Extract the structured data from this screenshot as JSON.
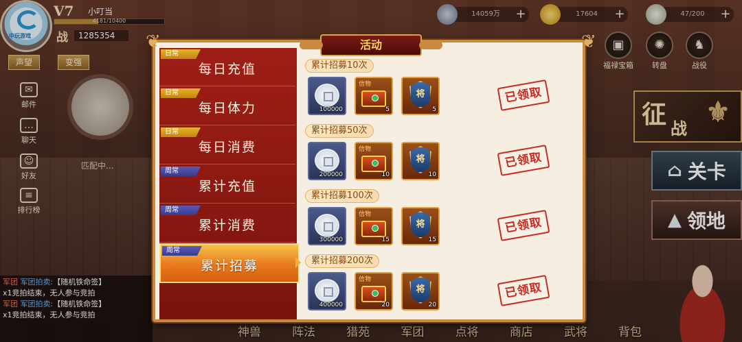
{
  "player": {
    "vip": "V7",
    "name": "小叮当",
    "exp": "4181/10400",
    "exp_fraction": 0.402,
    "power_label": "战",
    "power": "1285354",
    "logo": "中玩游戏",
    "btn_fame": "声望",
    "btn_strengthen": "变强"
  },
  "currencies": [
    {
      "icon": "copper-coin-icon",
      "value": "14059万"
    },
    {
      "icon": "gold-ingot-icon",
      "value": "17604"
    },
    {
      "icon": "stamina-icon",
      "value": "47/200"
    }
  ],
  "top_right_icons": [
    {
      "icon": "treasure-chest-icon",
      "label": "福禄宝箱"
    },
    {
      "icon": "wheel-icon",
      "label": "转盘"
    },
    {
      "icon": "campaign-icon",
      "label": "战役"
    }
  ],
  "left_icons": [
    {
      "icon": "mail-icon",
      "label": "邮件"
    },
    {
      "icon": "chat-icon",
      "label": "聊天"
    },
    {
      "icon": "friend-icon",
      "label": "好友"
    },
    {
      "icon": "ranking-icon",
      "label": "排行榜"
    }
  ],
  "match_text": "匹配中...",
  "right_buttons": {
    "conquest_1": "征",
    "conquest_2": "战",
    "stage": "关卡",
    "territory": "领地"
  },
  "chat": [
    {
      "tag": "军团",
      "channel": "军团拍卖:",
      "text": "【随机铁命签】"
    },
    {
      "tag": "",
      "channel": "",
      "text": "x1竞拍结束，无人参与竞拍"
    },
    {
      "tag": "军团",
      "channel": "军团拍卖:",
      "text": "【随机铁命签】"
    },
    {
      "tag": "",
      "channel": "",
      "text": "x1竞拍结束，无人参与竞拍"
    }
  ],
  "bottom_menu": [
    "神兽",
    "阵法",
    "猎苑",
    "军团",
    "点将",
    "商店",
    "武将",
    "背包"
  ],
  "panel": {
    "title": "活动",
    "tabs": [
      {
        "kind": "日常",
        "label": "每日充值",
        "type": "daily"
      },
      {
        "kind": "日常",
        "label": "每日体力",
        "type": "daily"
      },
      {
        "kind": "日常",
        "label": "每日消费",
        "type": "daily"
      },
      {
        "kind": "周常",
        "label": "累计充值",
        "type": "weekly"
      },
      {
        "kind": "周常",
        "label": "累计消费",
        "type": "weekly"
      },
      {
        "kind": "周常",
        "label": "累计招募",
        "type": "weekly",
        "active": true
      }
    ],
    "rewards": [
      {
        "title": "累计招募10次",
        "coin": "100000",
        "token_label": "信物",
        "token_qty": "5",
        "general_label": "将",
        "general_qty": "5",
        "status": "已领取"
      },
      {
        "title": "累计招募50次",
        "coin": "200000",
        "token_label": "信物",
        "token_qty": "10",
        "general_label": "将",
        "general_qty": "10",
        "status": "已领取"
      },
      {
        "title": "累计招募100次",
        "coin": "300000",
        "token_label": "信物",
        "token_qty": "15",
        "general_label": "将",
        "general_qty": "15",
        "status": "已领取"
      },
      {
        "title": "累计招募200次",
        "coin": "400000",
        "token_label": "信物",
        "token_qty": "20",
        "general_label": "将",
        "general_qty": "20",
        "status": "已领取"
      }
    ]
  },
  "colors": {
    "panel_bg": "#f6efe1",
    "tab_red": "#9e1e16",
    "tab_active": "#e87a1c",
    "stamp": "#c82a22",
    "title_gold": "#ffd15a"
  }
}
